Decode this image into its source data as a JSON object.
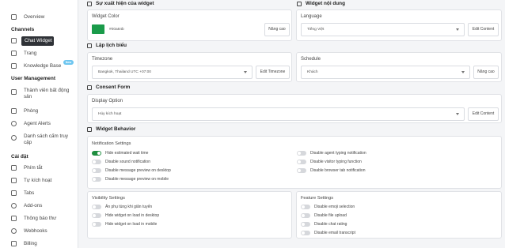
{
  "sidebar": {
    "overview": "Overview",
    "channels_heading": "Channels",
    "chat_widget": "Chat Widget",
    "trang": "Trang",
    "knowledge_base": "Knowledge Base",
    "new_badge": "New",
    "user_management_heading": "User Management",
    "members": "Thành viên bất động sản",
    "phong": "Phòng",
    "agent_alerts": "Agent Alerts",
    "blocked": "Danh sách cấm truy cập",
    "settings_heading": "Cài đặt",
    "shortcuts": "Phím tắt",
    "auto_trigger": "Tự kích hoạt",
    "tabs": "Tabs",
    "addons": "Add-ons",
    "notifications": "Thông báo thư",
    "webhooks": "Webhooks",
    "billing": "Billing"
  },
  "appearance": {
    "section_title": "Sự xuất hiện của widget",
    "widget_color_label": "Widget Color",
    "color_value": "#00a84b",
    "color_hex": "#1a9b4a",
    "advanced_button": "Nâng cao"
  },
  "content": {
    "section_title": "Widget nội dung",
    "language_label": "Language",
    "language_value": "Tiếng Việt",
    "edit_button": "Edit Content"
  },
  "schedule_section": {
    "section_title": "Lập lịch biểu",
    "timezone_label": "Timezone",
    "timezone_value": "Bangkok, Thailand UTC +07:00",
    "edit_timezone_button": "Edit Timezone",
    "schedule_label": "Schedule",
    "schedule_value": "Khách",
    "advanced_button": "Nâng cao"
  },
  "consent": {
    "section_title": "Consent Form",
    "display_option_label": "Display Option",
    "display_option_value": "Hủy kích hoạt",
    "edit_button": "Edit Content"
  },
  "behavior": {
    "section_title": "Widget Behavior",
    "notification_settings_title": "Notification Settings",
    "notif_left": [
      {
        "label": "Hide estimated wait time",
        "on": true
      },
      {
        "label": "Disable sound notification",
        "on": false
      },
      {
        "label": "Disable message preview on desktop",
        "on": false
      },
      {
        "label": "Disable message preview on mobile",
        "on": false
      }
    ],
    "notif_right": [
      {
        "label": "Disable agent typing notification",
        "on": false
      },
      {
        "label": "Disable visitor typing function",
        "on": false
      },
      {
        "label": "Disable browser tab notification",
        "on": false
      }
    ],
    "visibility_title": "Visibility Settings",
    "visibility": [
      {
        "label": "Ẩn phụ tùng khi giãn tuyến",
        "on": false
      },
      {
        "label": "Hide widget on load in desktop",
        "on": false
      },
      {
        "label": "Hide widget on load in mobile",
        "on": false
      }
    ],
    "feature_title": "Feature Settings",
    "features": [
      {
        "label": "Disable emoji selection",
        "on": false
      },
      {
        "label": "Disable file upload",
        "on": false
      },
      {
        "label": "Disable chat rating",
        "on": false
      },
      {
        "label": "Disable email transcript",
        "on": false
      }
    ]
  }
}
